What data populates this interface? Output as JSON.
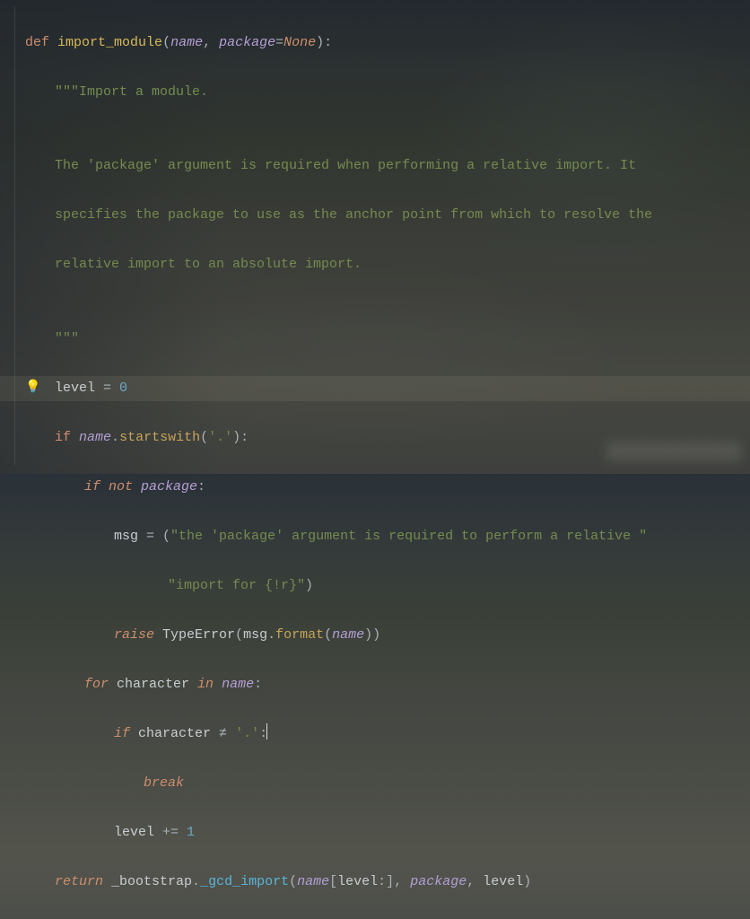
{
  "code": {
    "lines": [
      {
        "indent": 0,
        "type": "defline",
        "tokens": {
          "def": "def",
          "space": " ",
          "name": "import_module",
          "lpar": "(",
          "p1": "name",
          "comma": ", ",
          "p2": "package",
          "eq": "=",
          "none": "None",
          "rpar": ")",
          "colon": ":"
        }
      },
      {
        "indent": 1,
        "type": "doc",
        "text": "\"\"\"Import a module."
      },
      {
        "indent": 0,
        "type": "blank",
        "text": ""
      },
      {
        "indent": 1,
        "type": "doc",
        "text": "The 'package' argument is required when performing a relative import. It"
      },
      {
        "indent": 1,
        "type": "doc",
        "text": "specifies the package to use as the anchor point from which to resolve the"
      },
      {
        "indent": 1,
        "type": "doc",
        "text": "relative import to an absolute import."
      },
      {
        "indent": 0,
        "type": "blank",
        "text": ""
      },
      {
        "indent": 1,
        "type": "doc",
        "text": "\"\"\""
      },
      {
        "indent": 1,
        "type": "assign1",
        "tokens": {
          "var": "level",
          "op": " = ",
          "val": "0"
        }
      },
      {
        "indent": 1,
        "type": "ifstartswith",
        "tokens": {
          "if": "if",
          "sp": " ",
          "name": "name",
          "dot": ".",
          "method": "startswith",
          "lpar": "(",
          "arg": "'.'",
          "rpar": ")",
          "colon": ":"
        }
      },
      {
        "indent": 2,
        "type": "ifnotpkg",
        "tokens": {
          "if": "if",
          "not": " not ",
          "pkg": "package",
          "colon": ":"
        }
      },
      {
        "indent": 3,
        "type": "msg1",
        "tokens": {
          "msg": "msg",
          "op": " = ",
          "lpar": "(",
          "s": "\"the 'package' argument is required to perform a relative \""
        }
      },
      {
        "indent": 4,
        "type": "msg2",
        "tokens": {
          "pad": "   ",
          "s": "\"import for {!r}\"",
          "rpar": ")"
        }
      },
      {
        "indent": 3,
        "type": "raise",
        "tokens": {
          "raise": "raise",
          "sp": " ",
          "cls": "TypeError",
          "lpar": "(",
          "msg": "msg",
          "dot": ".",
          "fmt": "format",
          "lpar2": "(",
          "name": "name",
          "rpar2": ")",
          "rpar": ")"
        }
      },
      {
        "indent": 2,
        "type": "forchar",
        "tokens": {
          "for": "for",
          "sp": " ",
          "char": "character",
          "in": " in ",
          "name": "name",
          "colon": ":"
        }
      },
      {
        "indent": 3,
        "type": "ifchar",
        "tokens": {
          "if": "if",
          "sp": " ",
          "char": "character",
          "neq": " ≠ ",
          "dot": "'.'",
          "colon": ":"
        }
      },
      {
        "indent": 4,
        "type": "break",
        "tokens": {
          "break": "break"
        }
      },
      {
        "indent": 3,
        "type": "levelinc",
        "tokens": {
          "lvl": "level",
          "op": " += ",
          "one": "1"
        }
      },
      {
        "indent": 1,
        "type": "return",
        "tokens": {
          "ret": "return",
          "sp": " ",
          "mod": "_bootstrap",
          "dot": ".",
          "fn": "_gcd_import",
          "lpar": "(",
          "name": "name",
          "lbr": "[",
          "lvl": "level",
          "slice": ":",
          "rbr": "]",
          "c1": ", ",
          "pkg": "package",
          "c2": ", ",
          "lvl2": "level",
          "rpar": ")"
        }
      }
    ]
  },
  "gutter": {
    "bulb": "💡"
  }
}
